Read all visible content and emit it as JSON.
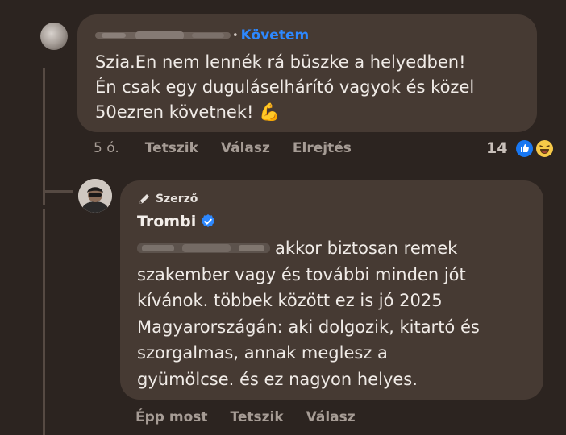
{
  "comment": {
    "follow_label": "Követem",
    "separator": "•",
    "text_lines": [
      "Szia.En nem lennék rá büszke a helyedben!",
      "Én csak egy duguláselhárító vagyok és közel",
      "50ezren követnek! 💪"
    ],
    "time": "5 ó.",
    "like_label": "Tetszik",
    "reply_label": "Válasz",
    "hide_label": "Elrejtés",
    "reaction_count": "14",
    "reaction_icons": [
      "like-icon",
      "laugh-icon"
    ]
  },
  "reply": {
    "author_badge": "Szerző",
    "author_name": "Trombi",
    "text_lines": [
      "akkor biztosan remek",
      "szakember vagy és további minden jót",
      "kívánok. többek között ez is jó 2025",
      "Magyarországán: aki dolgozik, kitartó és",
      "szorgalmas, annak meglesz a",
      "gyümölcse. és ez nagyon helyes."
    ],
    "time": "Épp most",
    "like_label": "Tetszik",
    "reply_label": "Válasz"
  },
  "colors": {
    "background": "#2c2420",
    "bubble": "#463a33",
    "accent": "#2d88ff",
    "muted": "#a69c95"
  }
}
